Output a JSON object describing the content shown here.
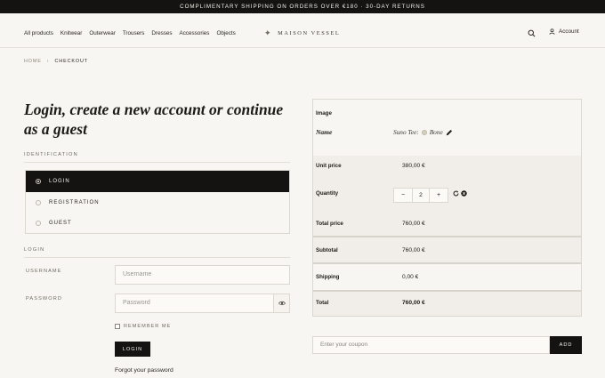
{
  "announcement": "COMPLIMENTARY SHIPPING ON ORDERS OVER €180 · 30-DAY RETURNS",
  "nav": [
    "All products",
    "Knitwear",
    "Outerwear",
    "Trousers",
    "Dresses",
    "Accessories",
    "Objects"
  ],
  "brand": "MAISON VESSEL",
  "header": {
    "account_label": "Account",
    "icons": [
      "search-icon",
      "user-icon"
    ]
  },
  "breadcrumb": {
    "home": "HOME",
    "separator": "›",
    "current": "CHECKOUT"
  },
  "page_title": "Login, create a new account or continue as a guest",
  "identification": {
    "label": "IDENTIFICATION",
    "options": [
      "LOGIN",
      "REGISTRATION",
      "GUEST"
    ],
    "selected": "LOGIN"
  },
  "login_form": {
    "section_label": "LOGIN",
    "username_label": "USERNAME",
    "username_placeholder": "Username",
    "password_label": "PASSWORD",
    "password_placeholder": "Password",
    "remember_label": "REMEMBER ME",
    "submit_label": "LOGIN",
    "forgot_label": "Forgot your password"
  },
  "cart": {
    "image_label": "Image",
    "name_label": "Name",
    "product_name": "Suno Tee:",
    "product_color": "Bone",
    "unit_price_label": "Unit price",
    "unit_price": "380,00 €",
    "quantity_label": "Quantity",
    "quantity": "2",
    "minus": "−",
    "plus": "+",
    "total_price_label": "Total price",
    "total_price": "760,00 €",
    "subtotal_label": "Subtotal",
    "subtotal": "760,00 €",
    "shipping_label": "Shipping",
    "shipping": "0,00 €",
    "total_label": "Total",
    "total": "760,00 €"
  },
  "coupon": {
    "placeholder": "Enter your coupon",
    "button_label": "ADD"
  },
  "colors": {
    "dark": "#141311",
    "background": "#f8f6f2",
    "panel": "#f1eee9",
    "border": "#dcd7cf"
  }
}
